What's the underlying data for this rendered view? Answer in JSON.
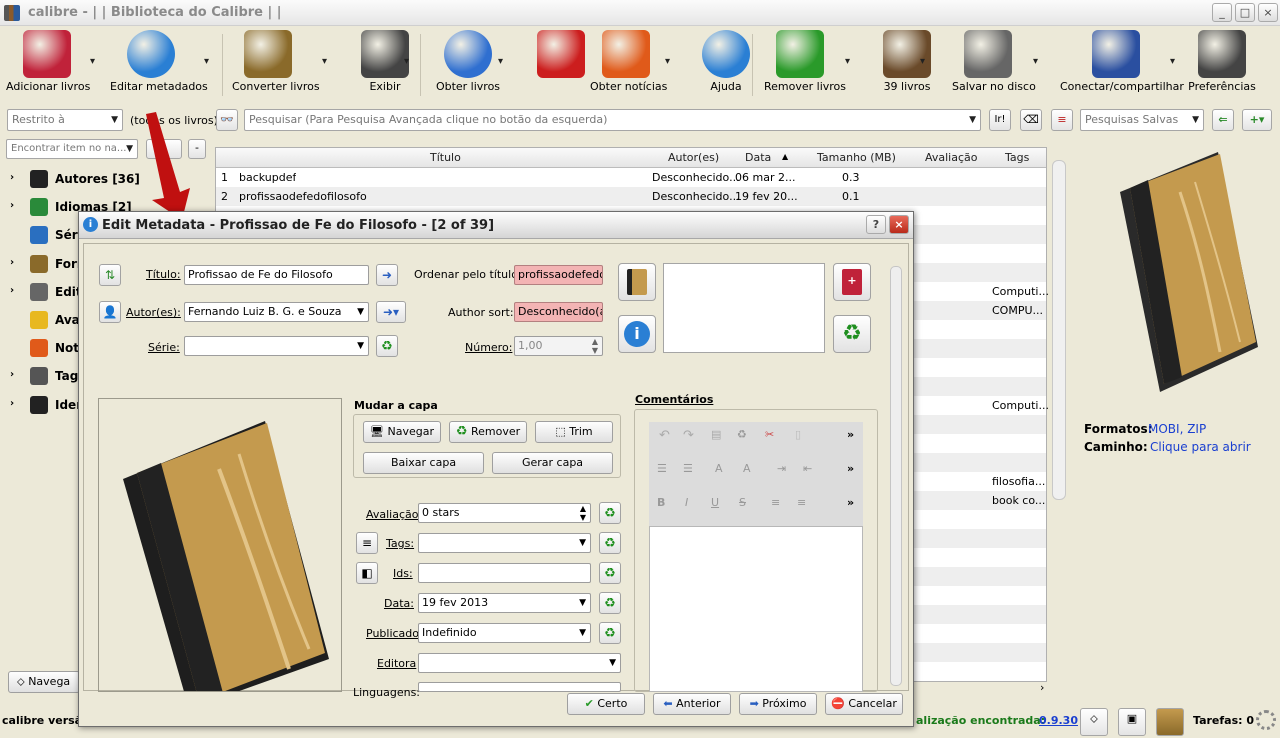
{
  "window": {
    "title": "calibre - | | Biblioteca do Calibre | |",
    "controls": [
      "_",
      "□",
      "×"
    ]
  },
  "toolbar": {
    "items": [
      {
        "label": "Adicionar livros",
        "icon": "add-book-icon",
        "color": "#c0223a"
      },
      {
        "label": "Editar metadados",
        "icon": "info-icon",
        "color": "#2a7fd4"
      },
      {
        "label": "Converter livros",
        "icon": "convert-icon",
        "color": "#8a6a2a"
      },
      {
        "label": "Exibir",
        "icon": "magnifier-icon",
        "color": "#444444"
      },
      {
        "label": "Obter livros",
        "icon": "globe-icon",
        "color": "#2f6fd0"
      },
      {
        "label": "",
        "icon": "heart-icon",
        "color": "#cc1e1e"
      },
      {
        "label": "Obter notícias",
        "icon": "news-icon",
        "color": "#e05a1a"
      },
      {
        "label": "Ajuda",
        "icon": "help-icon",
        "color": "#2a7fd4"
      },
      {
        "label": "Remover livros",
        "icon": "recycle-icon",
        "color": "#2a9a2a"
      },
      {
        "label": "39 livros",
        "icon": "books-icon",
        "color": "#6a4a2a"
      },
      {
        "label": "Salvar no disco",
        "icon": "disk-icon",
        "color": "#666666"
      },
      {
        "label": "Conectar/compartilhar",
        "icon": "network-icon",
        "color": "#2a4fa0"
      },
      {
        "label": "Preferências",
        "icon": "gear-icon",
        "color": "#444444"
      }
    ]
  },
  "search": {
    "restrict_placeholder": "Restrito à",
    "all_books": "(todos os livros)",
    "placeholder": "Pesquisar (Para Pesquisa Avançada clique no botão da esquerda)",
    "go": "Ir!",
    "saved": "Pesquisas Salvas",
    "find_item": "Encontrar item no na..."
  },
  "tree": [
    {
      "label": "Autores [36]",
      "icon": "person-icon",
      "color": "#222222"
    },
    {
      "label": "Idiomas [2]",
      "icon": "languages-icon",
      "color": "#2a8a3a"
    },
    {
      "label": "Séries",
      "icon": "series-icon",
      "color": "#2a6fc0"
    },
    {
      "label": "Formatos",
      "icon": "book-icon",
      "color": "#8a6a2a"
    },
    {
      "label": "Editoras",
      "icon": "publisher-icon",
      "color": "#666666"
    },
    {
      "label": "Avaliação",
      "icon": "star-icon",
      "color": "#e8b820"
    },
    {
      "label": "Notícias",
      "icon": "news-icon",
      "color": "#e05a1a"
    },
    {
      "label": "Tags",
      "icon": "tag-icon",
      "color": "#555555"
    },
    {
      "label": "Identificadores",
      "icon": "barcode-icon",
      "color": "#222222"
    }
  ],
  "table": {
    "columns": [
      "Título",
      "Autor(es)",
      "Data",
      "Tamanho (MB)",
      "Avaliação",
      "Tags"
    ],
    "rows": [
      {
        "n": "1",
        "title": "backupdef",
        "author": "Desconhecido...",
        "date": "06 mar 2...",
        "size": "0.3",
        "tags": ""
      },
      {
        "n": "2",
        "title": "profissaodefedofilosofo",
        "author": "Desconhecido...",
        "date": "19 fev 20...",
        "size": "0.1",
        "tags": ""
      }
    ],
    "tag_fragments": [
      "Computi...",
      "COMPU...",
      "Computi...",
      "filosofia...",
      "book co..."
    ]
  },
  "right_panel": {
    "formats_label": "Formatos:",
    "formats_value": "MOBI, ZIP",
    "path_label": "Caminho:",
    "path_value": "Clique para abrir"
  },
  "status": {
    "left": "calibre versã",
    "update": "alização encontrada:",
    "version": "0.9.30",
    "tasks": "Tarefas: 0",
    "navigate": "Navega"
  },
  "dialog": {
    "title": "Edit Metadata - Profissao de Fe do Filosofo -  [2 of 39]",
    "title_label": "Título:",
    "title_value": "Profissao de Fe do Filosofo",
    "sort_title_label": "Ordenar pelo título:",
    "sort_title_value": "profissaodefedofi",
    "authors_label": "Autor(es):",
    "authors_value": "Fernando Luiz B. G. e Souza",
    "author_sort_label": "Author sort:",
    "author_sort_value": "Desconhecido(a)",
    "series_label": "Série:",
    "series_value": "",
    "number_label": "Número:",
    "number_value": "1,00",
    "cover_group": "Mudar a capa",
    "browse": "Navegar",
    "remove": "Remover",
    "trim": "Trim",
    "download_cover": "Baixar capa",
    "generate_cover": "Gerar capa",
    "rating_label": "Avaliação",
    "rating_value": "0 stars",
    "tags_label": "Tags:",
    "ids_label": "Ids:",
    "date_label": "Data:",
    "date_value": "19 fev 2013",
    "published_label": "Publicado",
    "published_value": "Indefinido",
    "publisher_label": "Editora",
    "languages_label": "Linguagens:",
    "comments_label": "Comentários",
    "ok": "Certo",
    "prev": "Anterior",
    "next": "Próximo",
    "cancel": "Cancelar",
    "help_btn": "?",
    "close_btn": "×"
  }
}
